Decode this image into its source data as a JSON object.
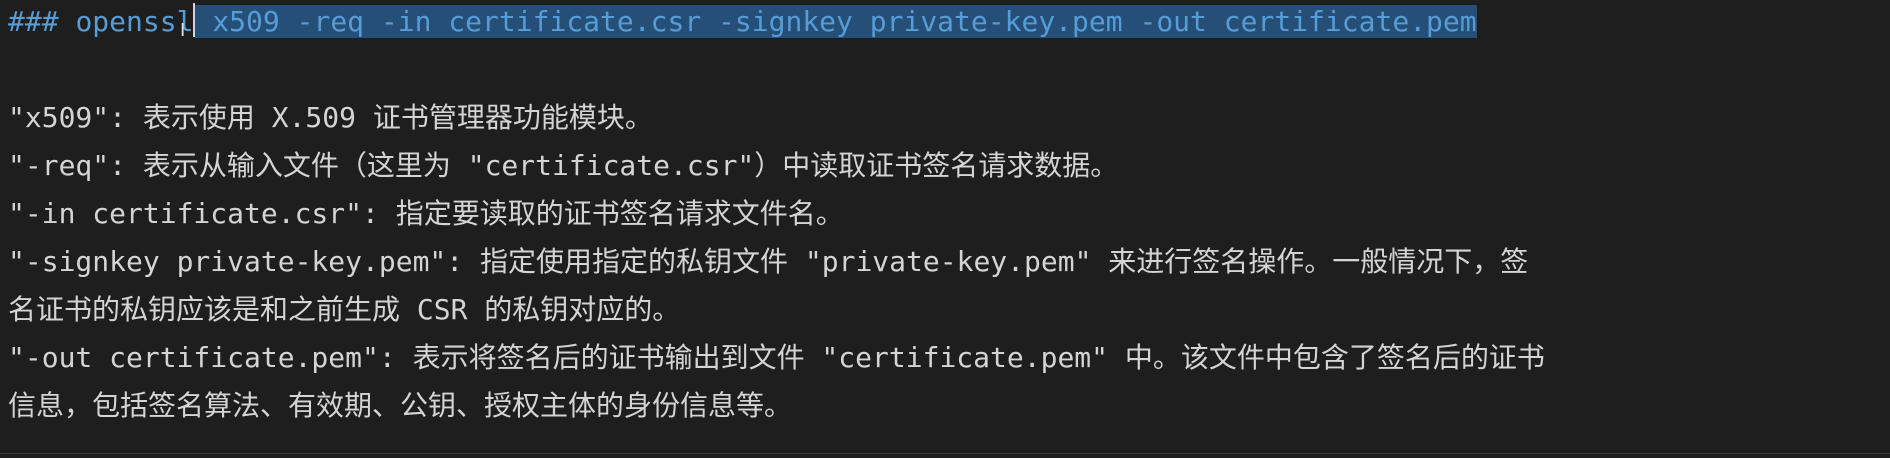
{
  "editor": {
    "heading_marker": "###",
    "heading_prefix": "openssl",
    "heading_selected": "x509 -req -in certificate.csr -signkey private-key.pem -out certificate.pem",
    "lines": [
      "\"x509\": 表示使用 X.509 证书管理器功能模块。",
      "\"-req\": 表示从输入文件（这里为 \"certificate.csr\"）中读取证书签名请求数据。",
      "\"-in certificate.csr\": 指定要读取的证书签名请求文件名。",
      "\"-signkey private-key.pem\": 指定使用指定的私钥文件 \"private-key.pem\" 来进行签名操作。一般情况下，签",
      "名证书的私钥应该是和之前生成 CSR 的私钥对应的。",
      "\"-out certificate.pem\": 表示将签名后的证书输出到文件 \"certificate.pem\" 中。该文件中包含了签名后的证书",
      "信息，包括签名算法、有效期、公钥、授权主体的身份信息等。"
    ]
  },
  "colors": {
    "background": "#1e1e1e",
    "text": "#d4d4d4",
    "heading": "#569cd6",
    "selection": "#264f78"
  }
}
